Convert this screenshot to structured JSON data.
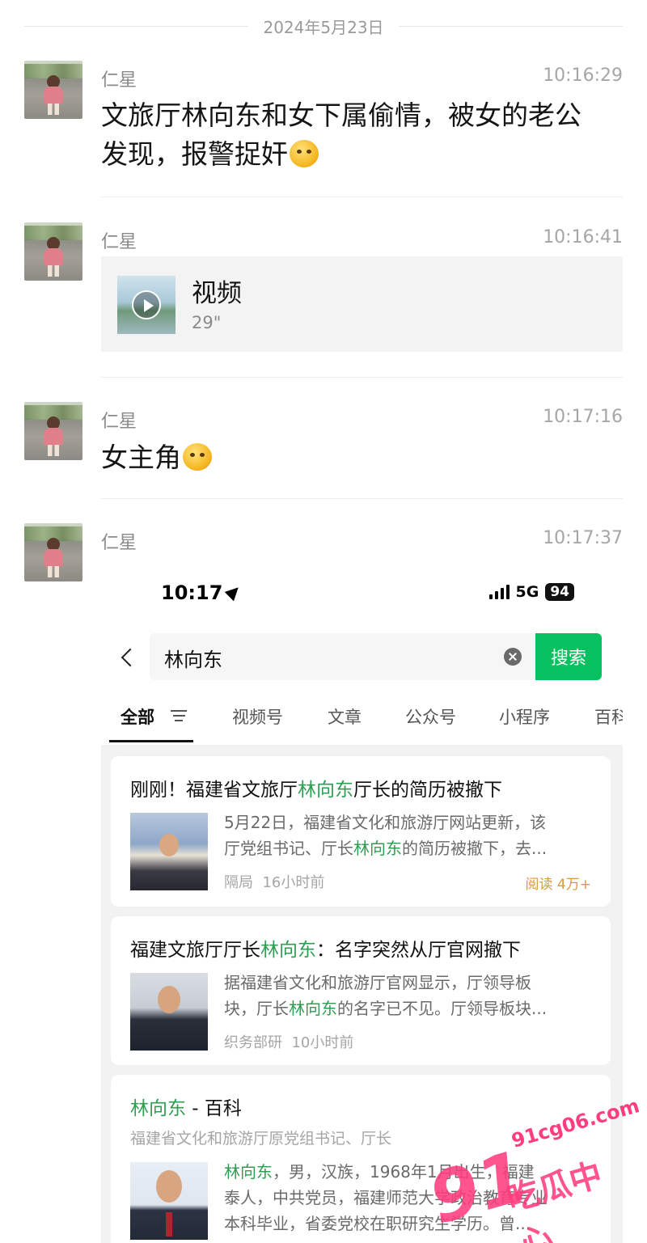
{
  "chat": {
    "date": "2024年5月23日",
    "messages": [
      {
        "sender": "仁星",
        "time": "10:16:29",
        "text_line1": "文旅厅林向东和女下属偷情，被女的老公",
        "text_line2": "发现，报警捉奸"
      },
      {
        "sender": "仁星",
        "time": "10:16:41",
        "video_title": "视频",
        "video_duration": "29\""
      },
      {
        "sender": "仁星",
        "time": "10:17:16",
        "text": "女主角"
      },
      {
        "sender": "仁星",
        "time": "10:17:37"
      }
    ]
  },
  "screenshot": {
    "status": {
      "clock": "10:17",
      "network": "5G",
      "battery": "94"
    },
    "search": {
      "query": "林向东",
      "button": "搜索"
    },
    "tabs": [
      "全部",
      "视频号",
      "文章",
      "公众号",
      "小程序",
      "百科"
    ],
    "results": [
      {
        "title_pre": "刚刚！福建省文旅厅",
        "title_hl": "林向东",
        "title_post": "厅长的简历被撤下",
        "snippet1": "5月22日，福建省文化和旅游厅网站更新，该",
        "snippet2_pre": "厅党组书记、厅长",
        "snippet2_hl": "林向东",
        "snippet2_post": "的简历被撤下，去...",
        "source": "隔局",
        "age": "16小时前",
        "reads": "阅读 4万+"
      },
      {
        "title_pre": "福建文旅厅厅长",
        "title_hl": "林向东",
        "title_post": "：名字突然从厅官网撤下",
        "snippet1": "据福建省文化和旅游厅官网显示，厅领导板",
        "snippet2_pre": "块，厅长",
        "snippet2_hl": "林向东",
        "snippet2_post": "的名字已不见。厅领导板块...",
        "source": "织务部研",
        "age": "10小时前"
      },
      {
        "title_hl": "林向东",
        "title_post": " - 百科",
        "subtitle": "福建省文化和旅游厅原党组书记、厅长",
        "snippet1_hl": "林向东",
        "snippet1_post": "，男，汉族，1968年1月出生，福建",
        "snippet2": "泰人，中共党员，福建师范大学政治教育专业",
        "snippet3": "本科毕业，省委党校在职研究生学历。曾..."
      }
    ]
  },
  "watermark": {
    "url": "91cg06.com",
    "number": "91",
    "text": "吃瓜中心",
    "color": "#ff3d7f"
  },
  "colors": {
    "wechat_green": "#07c160",
    "highlight": "#2f9d52"
  }
}
